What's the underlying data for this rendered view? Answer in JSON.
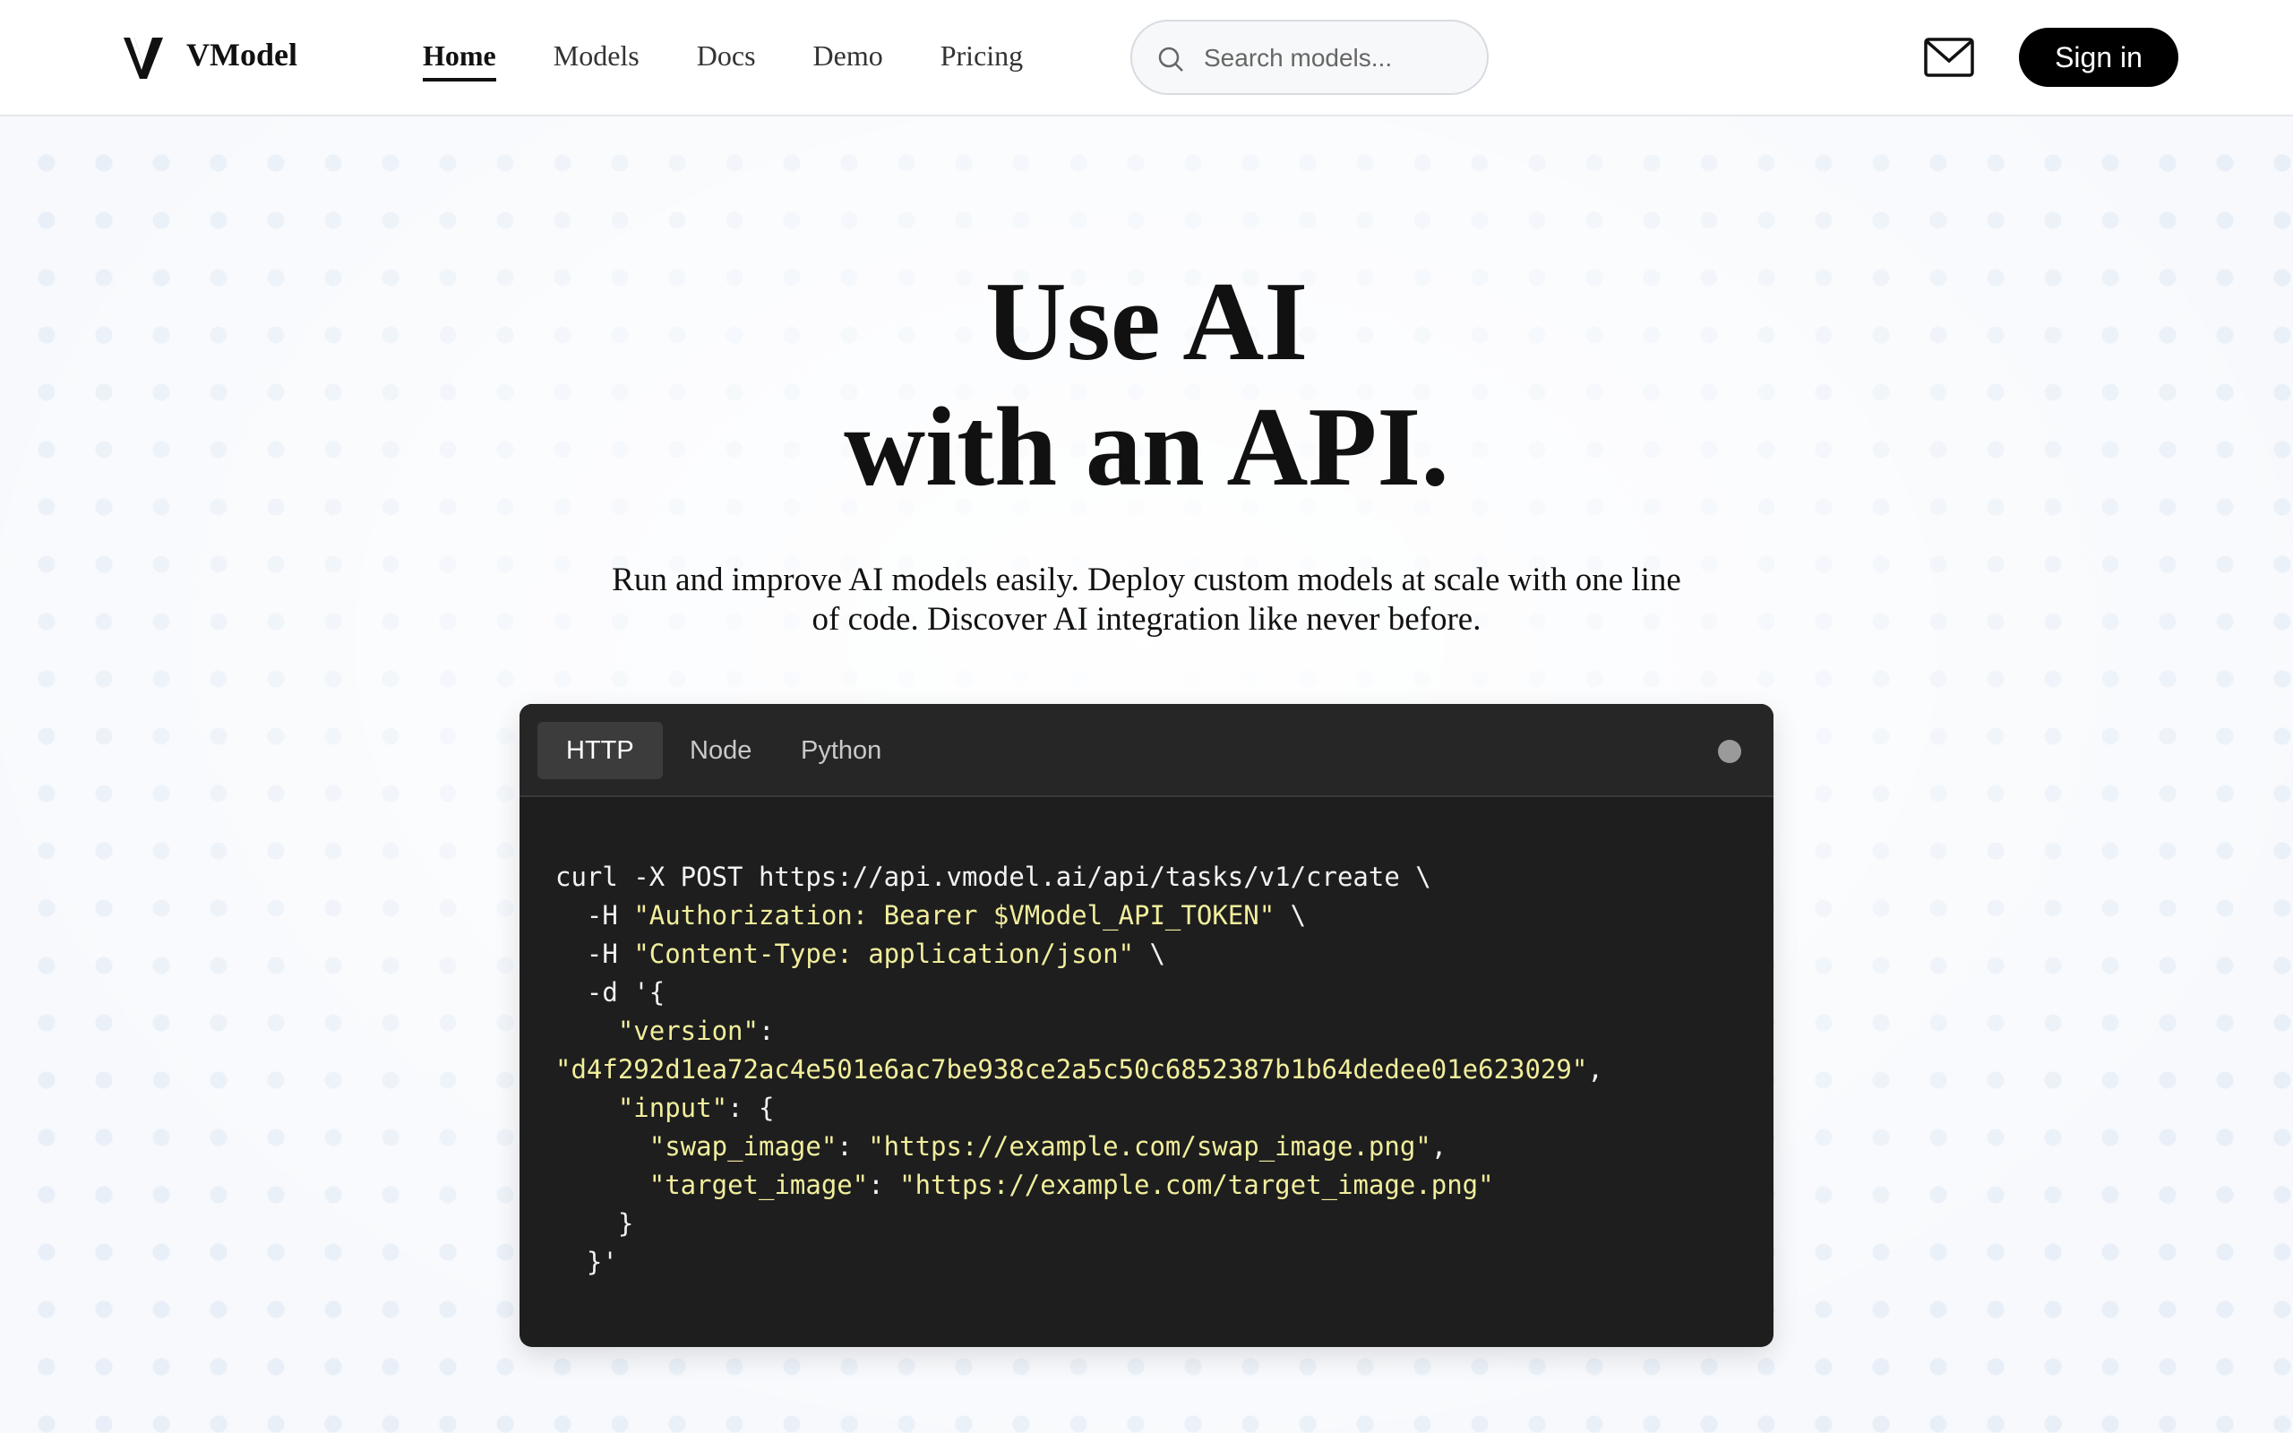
{
  "brand": {
    "name": "VModel"
  },
  "nav": [
    {
      "label": "Home",
      "active": true
    },
    {
      "label": "Models"
    },
    {
      "label": "Docs"
    },
    {
      "label": "Demo"
    },
    {
      "label": "Pricing"
    }
  ],
  "search": {
    "placeholder": "Search models..."
  },
  "header": {
    "signin_label": "Sign in"
  },
  "hero": {
    "title_line1": "Use AI",
    "title_line2": "with an API.",
    "subtitle": "Run and improve AI models easily. Deploy custom models at scale with one line of code. Discover AI integration like never before."
  },
  "code": {
    "tabs": [
      "HTTP",
      "Node",
      "Python"
    ],
    "active_tab": "HTTP",
    "lines": [
      "curl -X POST https://api.vmodel.ai/api/tasks/v1/create \\",
      "  -H \"Authorization: Bearer $VModel_API_TOKEN\" \\",
      "  -H \"Content-Type: application/json\" \\",
      "  -d '{",
      "    \"version\":",
      "\"d4f292d1ea72ac4e501e6ac7be938ce2a5c50c6852387b1b64dedee01e623029\",",
      "    \"input\": {",
      "      \"swap_image\": \"https://example.com/swap_image.png\",",
      "      \"target_image\": \"https://example.com/target_image.png\"",
      "    }",
      "  }'"
    ]
  },
  "colors": {
    "accent": "#000000",
    "code_bg": "#1e1e1e",
    "code_string": "#f1ee9c"
  }
}
